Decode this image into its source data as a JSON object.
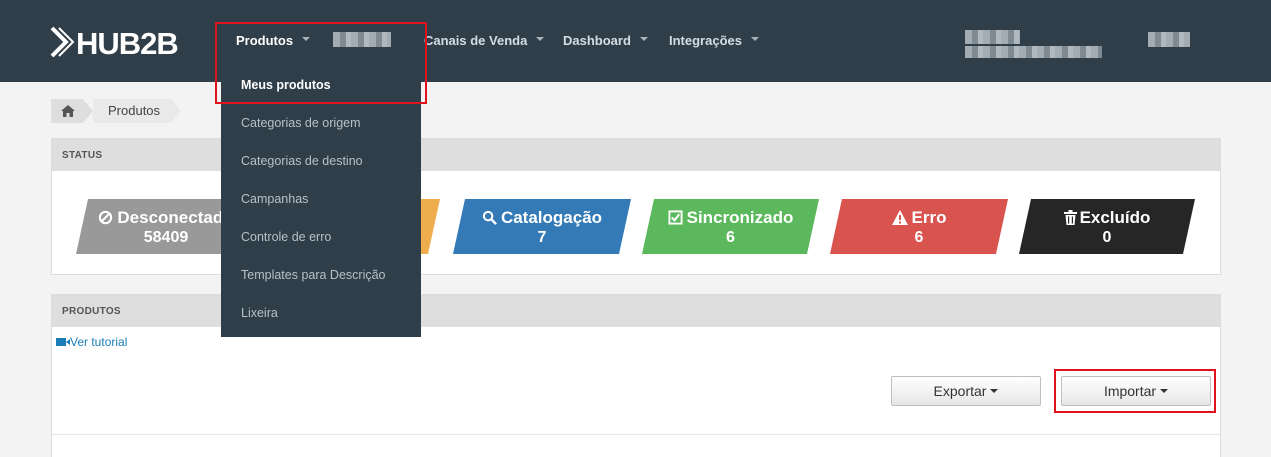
{
  "nav": {
    "logo": "HUB2B",
    "items": [
      {
        "label": "Produtos"
      },
      {
        "label": "Canais de Venda"
      },
      {
        "label": "Dashboard"
      },
      {
        "label": "Integrações"
      }
    ]
  },
  "dropdown": {
    "items": [
      {
        "label": "Meus produtos"
      },
      {
        "label": "Categorias de origem"
      },
      {
        "label": "Categorias de destino"
      },
      {
        "label": "Campanhas"
      },
      {
        "label": "Controle de erro"
      },
      {
        "label": "Templates para Descrição"
      },
      {
        "label": "Lixeira"
      }
    ]
  },
  "breadcrumb": {
    "current": "Produtos"
  },
  "status": {
    "title": "STATUS",
    "cards": [
      {
        "label": "Desconectado",
        "count": "58409",
        "color": "#999999",
        "icon": "ban-icon"
      },
      {
        "label": "",
        "count": "",
        "color": "#f0ad4e",
        "icon": ""
      },
      {
        "label": "Catalogação",
        "count": "7",
        "color": "#337ab7",
        "icon": "search-icon"
      },
      {
        "label": "Sincronizado",
        "count": "6",
        "color": "#5cb85c",
        "icon": "check-square-icon"
      },
      {
        "label": "Erro",
        "count": "6",
        "color": "#d9534f",
        "icon": "warning-icon"
      },
      {
        "label": "Excluído",
        "count": "0",
        "color": "#262626",
        "icon": "trash-icon"
      }
    ]
  },
  "products": {
    "title": "PRODUTOS",
    "tutorial": "Ver tutorial",
    "export_label": "Exportar",
    "import_label": "Importar"
  }
}
